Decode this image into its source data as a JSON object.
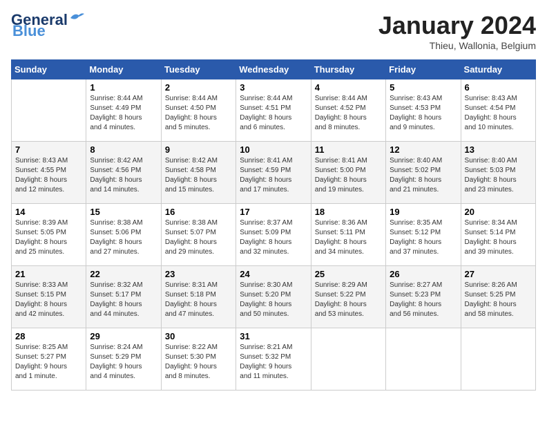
{
  "header": {
    "logo_line1": "General",
    "logo_line2": "Blue",
    "month": "January 2024",
    "location": "Thieu, Wallonia, Belgium"
  },
  "columns": [
    "Sunday",
    "Monday",
    "Tuesday",
    "Wednesday",
    "Thursday",
    "Friday",
    "Saturday"
  ],
  "weeks": [
    [
      {
        "day": "",
        "info": ""
      },
      {
        "day": "1",
        "info": "Sunrise: 8:44 AM\nSunset: 4:49 PM\nDaylight: 8 hours\nand 4 minutes."
      },
      {
        "day": "2",
        "info": "Sunrise: 8:44 AM\nSunset: 4:50 PM\nDaylight: 8 hours\nand 5 minutes."
      },
      {
        "day": "3",
        "info": "Sunrise: 8:44 AM\nSunset: 4:51 PM\nDaylight: 8 hours\nand 6 minutes."
      },
      {
        "day": "4",
        "info": "Sunrise: 8:44 AM\nSunset: 4:52 PM\nDaylight: 8 hours\nand 8 minutes."
      },
      {
        "day": "5",
        "info": "Sunrise: 8:43 AM\nSunset: 4:53 PM\nDaylight: 8 hours\nand 9 minutes."
      },
      {
        "day": "6",
        "info": "Sunrise: 8:43 AM\nSunset: 4:54 PM\nDaylight: 8 hours\nand 10 minutes."
      }
    ],
    [
      {
        "day": "7",
        "info": "Sunrise: 8:43 AM\nSunset: 4:55 PM\nDaylight: 8 hours\nand 12 minutes."
      },
      {
        "day": "8",
        "info": "Sunrise: 8:42 AM\nSunset: 4:56 PM\nDaylight: 8 hours\nand 14 minutes."
      },
      {
        "day": "9",
        "info": "Sunrise: 8:42 AM\nSunset: 4:58 PM\nDaylight: 8 hours\nand 15 minutes."
      },
      {
        "day": "10",
        "info": "Sunrise: 8:41 AM\nSunset: 4:59 PM\nDaylight: 8 hours\nand 17 minutes."
      },
      {
        "day": "11",
        "info": "Sunrise: 8:41 AM\nSunset: 5:00 PM\nDaylight: 8 hours\nand 19 minutes."
      },
      {
        "day": "12",
        "info": "Sunrise: 8:40 AM\nSunset: 5:02 PM\nDaylight: 8 hours\nand 21 minutes."
      },
      {
        "day": "13",
        "info": "Sunrise: 8:40 AM\nSunset: 5:03 PM\nDaylight: 8 hours\nand 23 minutes."
      }
    ],
    [
      {
        "day": "14",
        "info": "Sunrise: 8:39 AM\nSunset: 5:05 PM\nDaylight: 8 hours\nand 25 minutes."
      },
      {
        "day": "15",
        "info": "Sunrise: 8:38 AM\nSunset: 5:06 PM\nDaylight: 8 hours\nand 27 minutes."
      },
      {
        "day": "16",
        "info": "Sunrise: 8:38 AM\nSunset: 5:07 PM\nDaylight: 8 hours\nand 29 minutes."
      },
      {
        "day": "17",
        "info": "Sunrise: 8:37 AM\nSunset: 5:09 PM\nDaylight: 8 hours\nand 32 minutes."
      },
      {
        "day": "18",
        "info": "Sunrise: 8:36 AM\nSunset: 5:11 PM\nDaylight: 8 hours\nand 34 minutes."
      },
      {
        "day": "19",
        "info": "Sunrise: 8:35 AM\nSunset: 5:12 PM\nDaylight: 8 hours\nand 37 minutes."
      },
      {
        "day": "20",
        "info": "Sunrise: 8:34 AM\nSunset: 5:14 PM\nDaylight: 8 hours\nand 39 minutes."
      }
    ],
    [
      {
        "day": "21",
        "info": "Sunrise: 8:33 AM\nSunset: 5:15 PM\nDaylight: 8 hours\nand 42 minutes."
      },
      {
        "day": "22",
        "info": "Sunrise: 8:32 AM\nSunset: 5:17 PM\nDaylight: 8 hours\nand 44 minutes."
      },
      {
        "day": "23",
        "info": "Sunrise: 8:31 AM\nSunset: 5:18 PM\nDaylight: 8 hours\nand 47 minutes."
      },
      {
        "day": "24",
        "info": "Sunrise: 8:30 AM\nSunset: 5:20 PM\nDaylight: 8 hours\nand 50 minutes."
      },
      {
        "day": "25",
        "info": "Sunrise: 8:29 AM\nSunset: 5:22 PM\nDaylight: 8 hours\nand 53 minutes."
      },
      {
        "day": "26",
        "info": "Sunrise: 8:27 AM\nSunset: 5:23 PM\nDaylight: 8 hours\nand 56 minutes."
      },
      {
        "day": "27",
        "info": "Sunrise: 8:26 AM\nSunset: 5:25 PM\nDaylight: 8 hours\nand 58 minutes."
      }
    ],
    [
      {
        "day": "28",
        "info": "Sunrise: 8:25 AM\nSunset: 5:27 PM\nDaylight: 9 hours\nand 1 minute."
      },
      {
        "day": "29",
        "info": "Sunrise: 8:24 AM\nSunset: 5:29 PM\nDaylight: 9 hours\nand 4 minutes."
      },
      {
        "day": "30",
        "info": "Sunrise: 8:22 AM\nSunset: 5:30 PM\nDaylight: 9 hours\nand 8 minutes."
      },
      {
        "day": "31",
        "info": "Sunrise: 8:21 AM\nSunset: 5:32 PM\nDaylight: 9 hours\nand 11 minutes."
      },
      {
        "day": "",
        "info": ""
      },
      {
        "day": "",
        "info": ""
      },
      {
        "day": "",
        "info": ""
      }
    ]
  ]
}
